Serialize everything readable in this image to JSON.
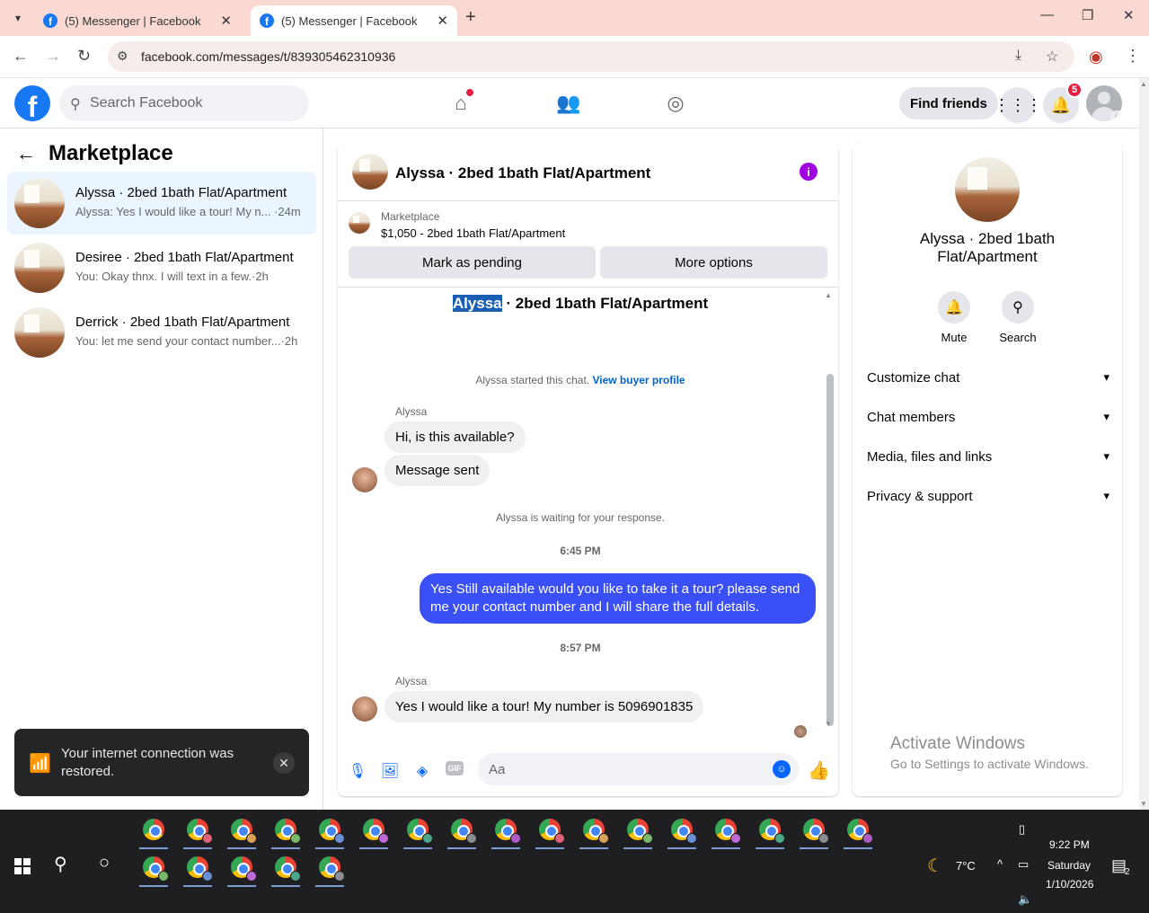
{
  "browser": {
    "tabs": [
      {
        "title": "(5) Messenger | Facebook"
      },
      {
        "title": "(5) Messenger | Facebook"
      }
    ],
    "url": "facebook.com/messages/t/839305462310936"
  },
  "fb": {
    "logo": "f",
    "search_placeholder": "Search Facebook",
    "find_friends": "Find friends",
    "notifications_count": "5"
  },
  "left": {
    "title": "Marketplace",
    "conversations": [
      {
        "name": "Alyssa · 2bed 1bath Flat/Apartment",
        "preview": "Alyssa: Yes I would like a tour! My n... ·24m"
      },
      {
        "name": "Desiree · 2bed 1bath Flat/Apartment",
        "preview": "You: Okay thnx. I will text in a few.·2h"
      },
      {
        "name": "Derrick · 2bed 1bath Flat/Apartment",
        "preview": "You: let me send your contact number...·2h"
      }
    ]
  },
  "toast": {
    "message": "Your internet connection was restored."
  },
  "chat": {
    "title": "Alyssa · 2bed 1bath Flat/Apartment",
    "marketplace_label": "Marketplace",
    "listing": "$1,050 - 2bed 1bath Flat/Apartment",
    "mark_pending": "Mark as pending",
    "more_options": "More options",
    "thread_name_highlight": "Alyssa",
    "thread_name_rest": " · 2bed 1bath Flat/Apartment",
    "started_text": "Alyssa started this chat. ",
    "view_buyer": "View buyer profile",
    "sender_1": "Alyssa",
    "msg_1": "Hi, is this available?",
    "msg_2": "Message sent",
    "waiting": "Alyssa is waiting for your response.",
    "time_1": "6:45 PM",
    "msg_out": "Yes Still available would you like to take it a tour? please send me your contact number and I will share the full details.",
    "time_2": "8:57 PM",
    "sender_2": "Alyssa",
    "msg_3": "Yes I would like a tour! My number is 5096901835",
    "composer_placeholder": "Aa",
    "gif_label": "GIF"
  },
  "right": {
    "name": "Alyssa · 2bed 1bath Flat/Apartment",
    "mute": "Mute",
    "search": "Search",
    "sections": [
      "Customize chat",
      "Chat members",
      "Media, files and links",
      "Privacy & support"
    ],
    "activate_title": "Activate Windows",
    "activate_sub": "Go to Settings to activate Windows."
  },
  "taskbar": {
    "weather": "7°C",
    "time": "9:22 PM",
    "day": "Saturday",
    "date": "1/10/2026",
    "notif_count": "2"
  },
  "colors": {
    "fb_blue": "#1877f2",
    "messenger_out": "#3a4ff5",
    "tab_strip": "#fad9d2",
    "notif_red": "#e41e3f"
  }
}
